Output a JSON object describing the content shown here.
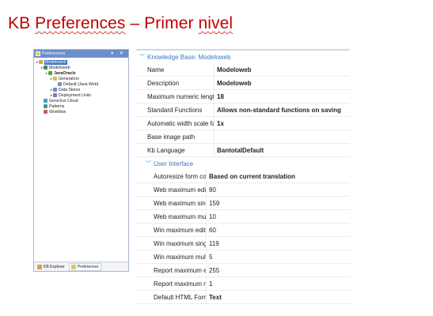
{
  "slide": {
    "title_part1": "KB ",
    "title_part2": "Preferences",
    "title_part3": " – Primer ",
    "title_part4": "nivel"
  },
  "panel": {
    "title": "Preferences",
    "header_buttons": "▾ ✕",
    "tree": [
      {
        "label": "Modeloweb",
        "depth": 0,
        "selected": true,
        "icon": "kb-icon"
      },
      {
        "label": "Modeloweb",
        "depth": 1,
        "icon": "model-icon"
      },
      {
        "label": "JavaOracle",
        "depth": 2,
        "bold": true,
        "icon": "environment-icon"
      },
      {
        "label": "Generators",
        "depth": 3,
        "icon": "folder-icon"
      },
      {
        "label": "Default (Java Web)",
        "depth": 4,
        "icon": "generator-icon"
      },
      {
        "label": "Data Stores",
        "depth": 3,
        "icon": "database-icon"
      },
      {
        "label": "Deployment Units",
        "depth": 3,
        "icon": "deploy-icon"
      },
      {
        "label": "GeneXus Cloud",
        "depth": 1,
        "icon": "cloud-icon"
      },
      {
        "label": "Patterns",
        "depth": 1,
        "icon": "patterns-icon"
      },
      {
        "label": "Workflow",
        "depth": 1,
        "icon": "workflow-icon"
      }
    ],
    "tabs": [
      {
        "label": "KB Explorer",
        "icon": "kb-explorer-icon",
        "active": false
      },
      {
        "label": "Preferences",
        "icon": "preferences-icon",
        "active": true
      }
    ]
  },
  "grid": {
    "kb_section": "Knowledge Base: Modeloweb",
    "kb_rows": [
      {
        "name": "Name",
        "value": "Modeloweb",
        "bold": true
      },
      {
        "name": "Description",
        "value": "Modeloweb",
        "bold": true
      },
      {
        "name": "Maximum numeric length",
        "value": "18",
        "bold": true
      },
      {
        "name": "Standard Functions",
        "value": "Allows non-standard functions on saving",
        "bold": true
      },
      {
        "name": "Automatic width scale fact",
        "value": "1x",
        "bold": true
      },
      {
        "name": "Base image path",
        "value": "",
        "bold": false
      },
      {
        "name": "Kb Language",
        "value": "BantotalDefault",
        "bold": true
      }
    ],
    "ui_section": "User Interface",
    "ui_rows": [
      {
        "name": "Autoresize form controls",
        "value": "Based on current translation",
        "bold": true
      },
      {
        "name": "Web maximum edit leng",
        "value": "80",
        "bold": false
      },
      {
        "name": "Web maximum single lin",
        "value": "159",
        "bold": false
      },
      {
        "name": "Web maximum multi lin",
        "value": "10",
        "bold": false
      },
      {
        "name": "Win maximum edit lengt",
        "value": "60",
        "bold": false
      },
      {
        "name": "Win maximum single lin",
        "value": "119",
        "bold": false
      },
      {
        "name": "Win maximum multi line",
        "value": "5",
        "bold": false
      },
      {
        "name": "Report maximum edit le",
        "value": "255",
        "bold": false
      },
      {
        "name": "Report maximum multi l",
        "value": "1",
        "bold": false
      },
      {
        "name": "Default HTML Format (T",
        "value": "Text",
        "bold": true
      }
    ]
  },
  "colors": {
    "title": "#c00000",
    "panel_header": "#6b8fc9",
    "selection": "#3b73c4",
    "section": "#3a78c2"
  }
}
